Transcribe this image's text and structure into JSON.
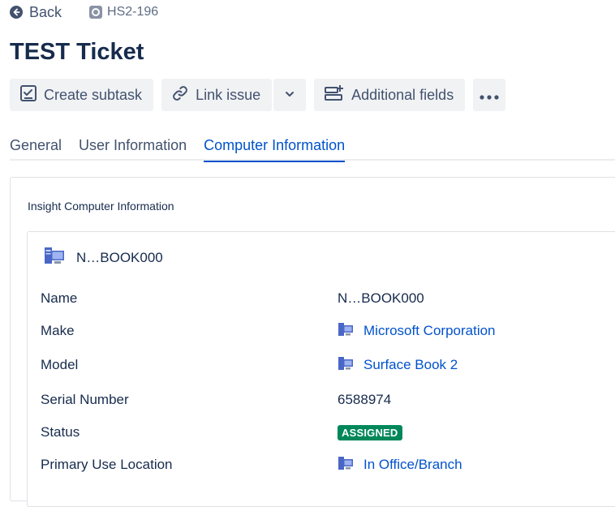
{
  "nav": {
    "back_label": "Back",
    "issue_key": "HS2-196"
  },
  "issue": {
    "title": "TEST Ticket"
  },
  "toolbar": {
    "create_subtask_label": "Create subtask",
    "link_issue_label": "Link issue",
    "additional_fields_label": "Additional fields"
  },
  "tabs": [
    {
      "label": "General",
      "active": false
    },
    {
      "label": "User Information",
      "active": false
    },
    {
      "label": "Computer Information",
      "active": true
    }
  ],
  "insight": {
    "section_title": "Insight Computer Information",
    "object_name": "N…BOOK000",
    "attributes": [
      {
        "label": "Name",
        "value": "N…BOOK000"
      },
      {
        "label": "Make",
        "value": "Microsoft Corporation",
        "is_link": true,
        "icon": "computer-object-icon"
      },
      {
        "label": "Model",
        "value": "Surface Book 2",
        "is_link": true,
        "icon": "computer-object-icon"
      },
      {
        "label": "Serial Number",
        "value": "6588974"
      },
      {
        "label": "Status",
        "value": "ASSIGNED",
        "status_color": "#00875a"
      },
      {
        "label": "Primary Use Location",
        "value": "In Office/Branch",
        "is_link": true,
        "icon": "computer-object-icon"
      }
    ]
  },
  "colors": {
    "link": "#0052cc",
    "text": "#172b4d",
    "button_bg": "#f1f2f4",
    "status_green": "#00875a"
  }
}
